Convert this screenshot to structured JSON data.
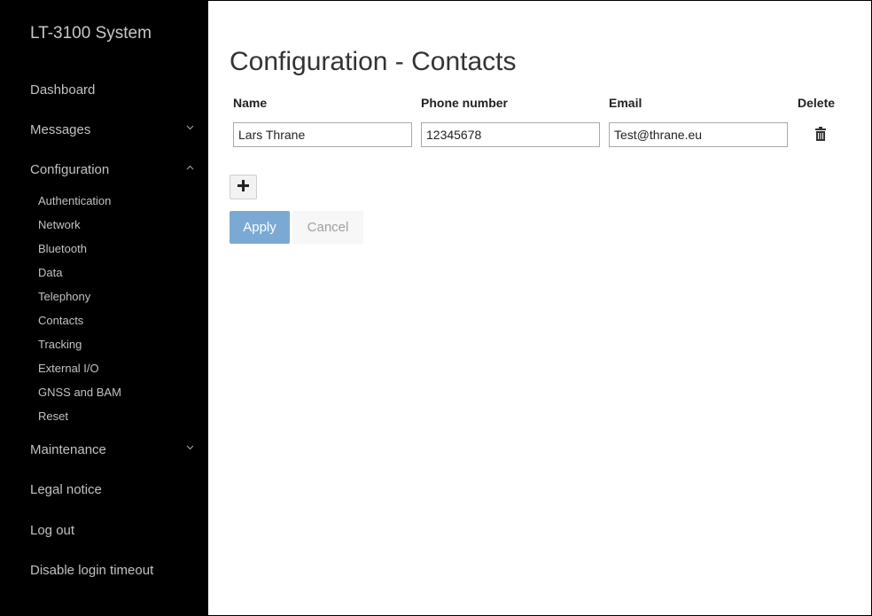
{
  "sidebar": {
    "title": "LT-3100 System",
    "nav": [
      {
        "label": "Dashboard",
        "chevron": ""
      },
      {
        "label": "Messages",
        "chevron": "⌄"
      },
      {
        "label": "Configuration",
        "chevron": "⌃"
      },
      {
        "label": "Maintenance",
        "chevron": "⌄"
      },
      {
        "label": "Legal notice",
        "chevron": ""
      },
      {
        "label": "Log out",
        "chevron": ""
      },
      {
        "label": "Disable login timeout",
        "chevron": ""
      }
    ],
    "config_sub": [
      "Authentication",
      "Network",
      "Bluetooth",
      "Data",
      "Telephony",
      "Contacts",
      "Tracking",
      "External I/O",
      "GNSS and BAM",
      "Reset"
    ]
  },
  "main": {
    "title": "Configuration - Contacts",
    "columns": {
      "name": "Name",
      "phone": "Phone number",
      "email": "Email",
      "delete": "Delete"
    },
    "rows": [
      {
        "name": "Lars Thrane",
        "phone": "12345678",
        "email": "Test@thrane.eu"
      }
    ],
    "add_label": "+",
    "apply_label": "Apply",
    "cancel_label": "Cancel"
  },
  "icons": {
    "add": "plus-icon",
    "delete": "trash-icon",
    "expand": "chevron-down-icon",
    "collapse": "chevron-up-icon"
  },
  "colors": {
    "sidebar_bg": "#000000",
    "sidebar_text": "#c2c2c2",
    "apply_bg": "#7aaad4",
    "cancel_text": "#a0a0a0"
  }
}
